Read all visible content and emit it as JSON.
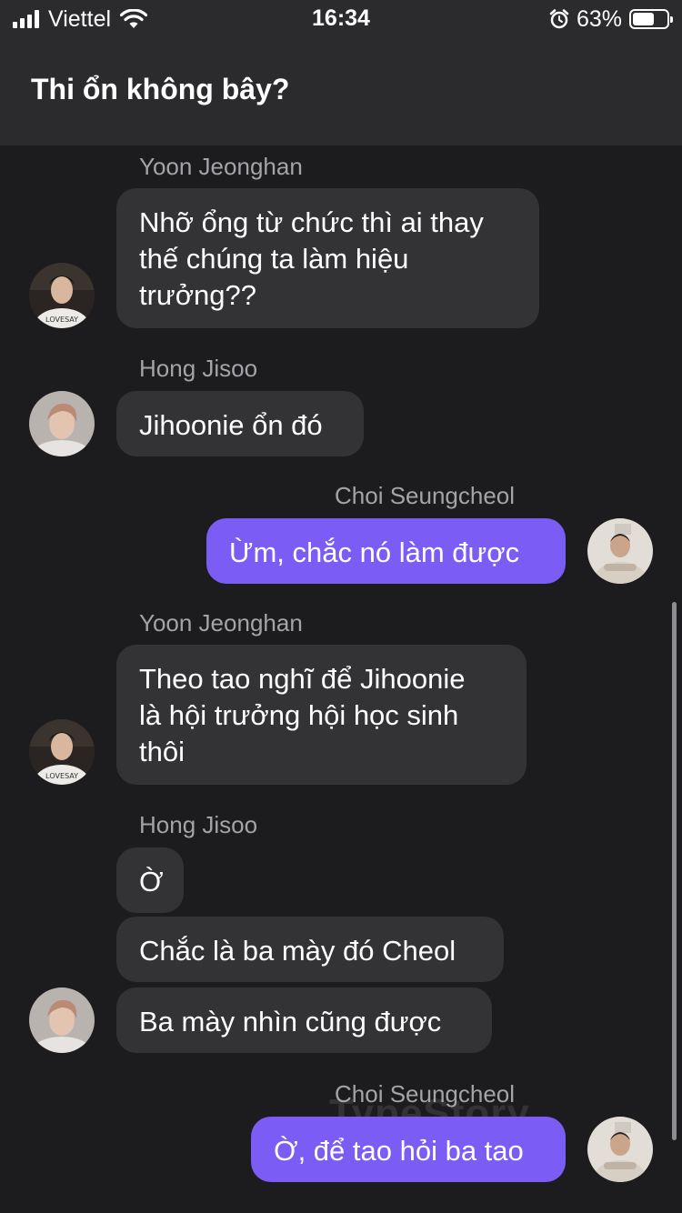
{
  "status_bar": {
    "carrier": "Viettel",
    "time": "16:34",
    "battery": "63%"
  },
  "header": {
    "title": "Thi ổn không bây?"
  },
  "messages": [
    {
      "sender": "Yoon Jeonghan",
      "lines": [
        "Nhỡ ổng từ chức thì ai thay",
        "thế chúng ta làm hiệu",
        "trưởng??"
      ]
    },
    {
      "sender": "Hong Jisoo",
      "text": "Jihoonie ổn đó"
    },
    {
      "sender": "Choi Seungcheol",
      "text": "Ừm, chắc nó làm được"
    },
    {
      "sender": "Yoon Jeonghan",
      "lines": [
        "Theo tao nghĩ để Jihoonie",
        "là hội trưởng hội học sinh",
        "thôi"
      ]
    },
    {
      "sender": "Hong Jisoo",
      "texts": [
        "Ờ",
        "Chắc là ba mày đó Cheol",
        "Ba mày nhìn cũng được"
      ]
    },
    {
      "sender": "Choi Seungcheol",
      "text": "Ờ, để tao hỏi ba tao"
    }
  ],
  "watermark": "TypeStory",
  "colors": {
    "background": "#1c1c1e",
    "bubble_other": "#333336",
    "bubble_mine": "#7b5cf5",
    "sender": "#a4a4a8"
  }
}
